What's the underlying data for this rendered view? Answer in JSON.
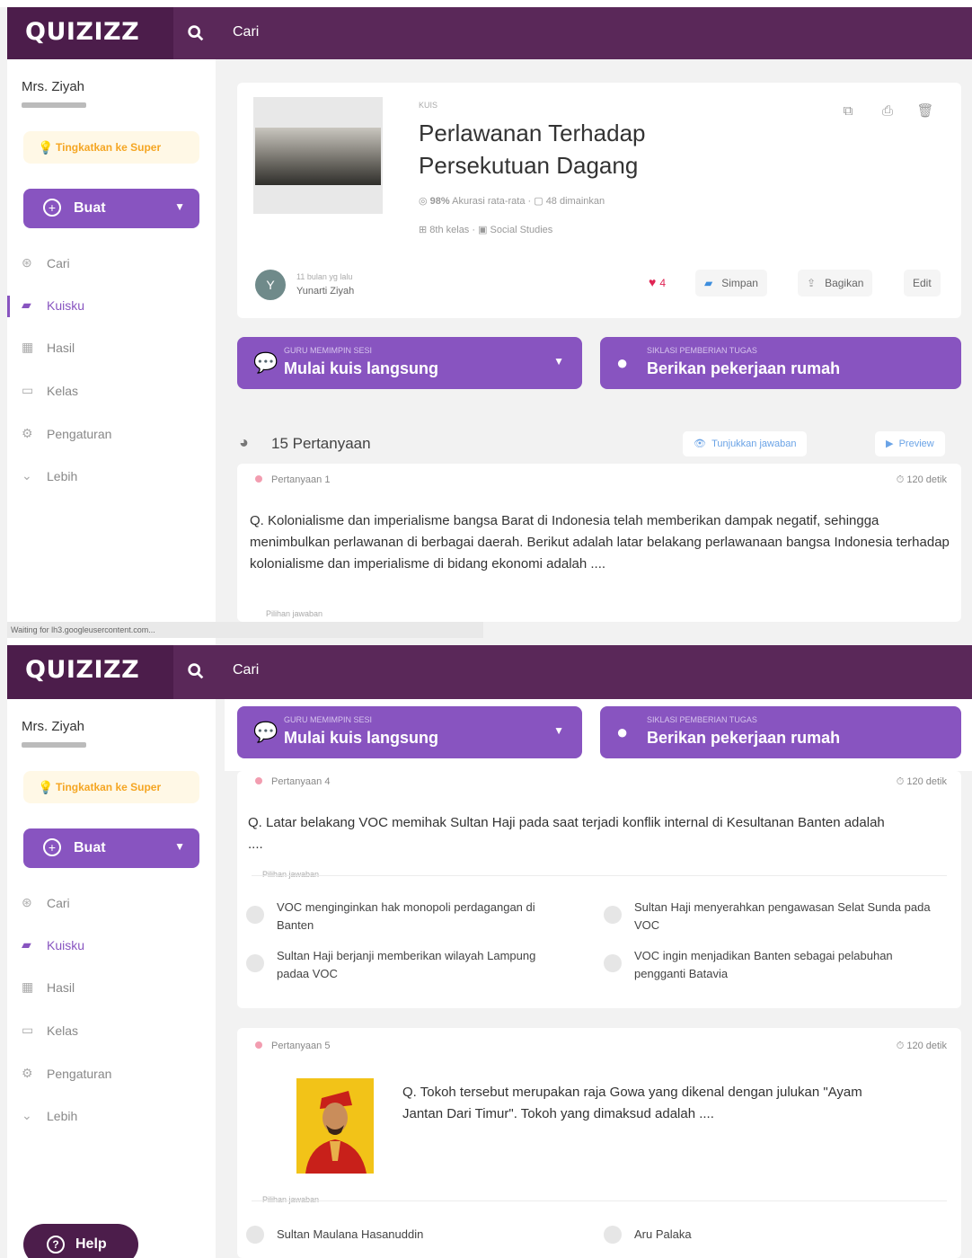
{
  "app": {
    "logo": "QUIZIZZ",
    "search_label": "Cari"
  },
  "sidebar": {
    "teacher_name": "Mrs. Ziyah",
    "upgrade_label": "Tingkatkan ke Super",
    "create_label": "Buat",
    "items": [
      {
        "label": "Cari",
        "icon": "compass-icon"
      },
      {
        "label": "Kuisku",
        "icon": "folder-icon"
      },
      {
        "label": "Hasil",
        "icon": "chart-icon"
      },
      {
        "label": "Kelas",
        "icon": "classroom-icon"
      },
      {
        "label": "Pengaturan",
        "icon": "gear-icon"
      },
      {
        "label": "Lebih",
        "icon": "chevron-down-icon"
      }
    ]
  },
  "quiz": {
    "type_label": "KUIS",
    "title_line1": "Perlawanan Terhadap",
    "title_line2": "Persekutuan Dagang",
    "accuracy": "98%",
    "accuracy_label": "Akurasi rata-rata",
    "plays": "48 dimainkan",
    "grade": "8th kelas",
    "subject": "Social Studies",
    "author_time": "11 bulan yg lalu",
    "author_name": "Yunarti Ziyah",
    "avatar_initial": "Y",
    "likes": "4",
    "save_label": "Simpan",
    "share_label": "Bagikan",
    "edit_label": "Edit"
  },
  "actions": {
    "live_small": "GURU MEMIMPIN SESI",
    "live_label": "Mulai kuis langsung",
    "homework_small": "SIKLASI PEMBERIAN TUGAS",
    "homework_label": "Berikan pekerjaan rumah"
  },
  "questions_header": {
    "count_label": "15 Pertanyaan",
    "show_answers": "Tunjukkan jawaban",
    "preview": "Preview"
  },
  "questions": [
    {
      "label": "Pertanyaan 1",
      "time": "120 detik",
      "text": "Q. Kolonialisme dan imperialisme bangsa Barat di Indonesia telah memberikan dampak negatif, sehingga menimbulkan perlawanan di berbagai daerah. Berikut adalah latar belakang perlawanaan bangsa Indonesia terhadap kolonialisme dan imperialisme di bidang ekonomi adalah ....",
      "choices_label": "Pilihan jawaban"
    },
    {
      "label": "Pertanyaan 4",
      "time": "120 detik",
      "text": "Q. Latar belakang VOC memihak Sultan Haji pada saat terjadi konflik internal di Kesultanan Banten adalah ....",
      "choices_label": "Pilihan jawaban",
      "options": [
        "VOC menginginkan hak monopoli perdagangan di Banten",
        "Sultan Haji menyerahkan pengawasan Selat Sunda pada VOC",
        "Sultan Haji berjanji memberikan wilayah Lampung padaa VOC",
        "VOC ingin menjadikan Banten sebagai pelabuhan pengganti Batavia"
      ]
    },
    {
      "label": "Pertanyaan 5",
      "time": "120 detik",
      "text": "Q. Tokoh tersebut merupakan raja Gowa yang dikenal dengan julukan \"Ayam Jantan Dari Timur\". Tokoh yang dimaksud adalah ....",
      "choices_label": "Pilihan jawaban",
      "options": [
        "Sultan Maulana Hasanuddin",
        "Aru Palaka"
      ]
    }
  ],
  "status_text": "Waiting for lh3.googleusercontent.com...",
  "help_label": "Help",
  "colors": {
    "brand": "#4c1d4b",
    "accent": "#8854c0",
    "like": "#e02454"
  }
}
